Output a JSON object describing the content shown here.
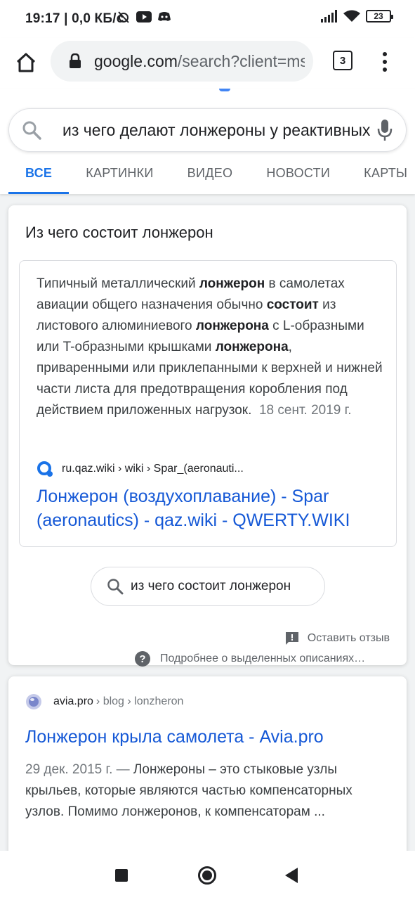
{
  "status_bar": {
    "text": "19:17 | 0,0 КБ/с",
    "battery": "23"
  },
  "browser": {
    "url_host": "google.com",
    "url_path": "/search?client=ms-android",
    "tab_count": "3"
  },
  "search": {
    "query": "из чего делают лонжероны у реактивных самолетов",
    "tabs": [
      {
        "label": "ВСЕ",
        "active": true
      },
      {
        "label": "КАРТИНКИ",
        "active": false
      },
      {
        "label": "ВИДЕО",
        "active": false
      },
      {
        "label": "НОВОСТИ",
        "active": false
      },
      {
        "label": "КАРТЫ",
        "active": false
      }
    ]
  },
  "featured": {
    "title": "Из чего состоит лонжерон",
    "snippet": {
      "t1": "Типичный металлический ",
      "b1": "лонжерон",
      "t2": " в самолетах авиации общего назначения обычно ",
      "b2": "состоит",
      "t3": " из листового алюминиевого ",
      "b3": "лонжерона",
      "t4": " с L-образными или T-образными крышками ",
      "b4": "лонжерона",
      "t5": ", приваренными или приклепанными к верхней и нижней части листа для предотвращения коробления под действием приложенных нагрузок.",
      "date": "18 сент. 2019 г."
    },
    "source_url": "ru.qaz.wiki › wiki › Spar_(aeronauti...",
    "link_title": "Лонжерон (воздухоплавание) - Spar (aeronautics) - qaz.wiki - QWERTY.WIKI",
    "related_chip": "из чего состоит лонжерон",
    "feedback": "Оставить отзыв",
    "about": "Подробнее о выделенных описаниях…"
  },
  "result2": {
    "host": "avia.pro",
    "path": "› blog › lonzheron",
    "title": "Лонжерон крыла самолета - Avia.pro",
    "date": "29 дек. 2015 г. —",
    "snippet": " Лонжероны – это стыковые узлы крыльев, которые являются частью компенсаторных узлов. Помимо лонжеронов, к компенсаторам ..."
  },
  "colors": {
    "accent": "#1a73e8",
    "link": "#1558d6"
  }
}
